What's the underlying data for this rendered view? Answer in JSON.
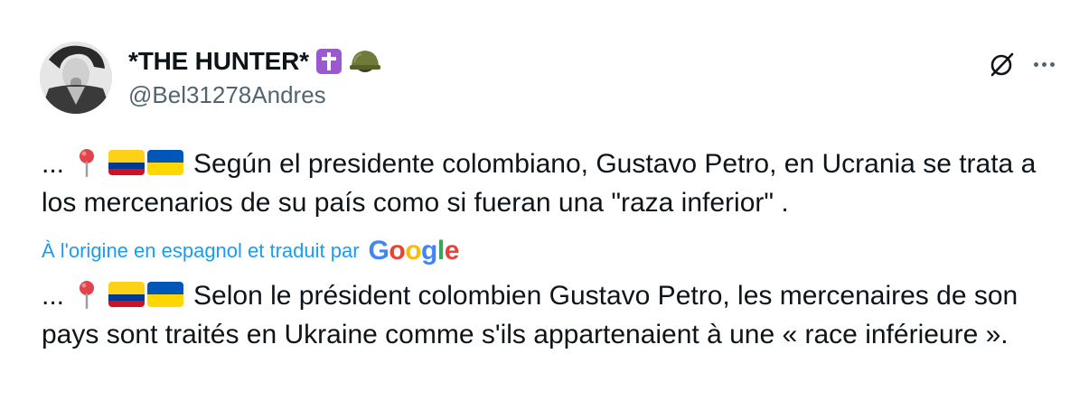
{
  "author": {
    "display_name": "*THE HUNTER*",
    "badges": [
      "latin-cross-icon",
      "military-helmet-icon"
    ],
    "handle": "@Bel31278Andres"
  },
  "header_actions": [
    "grok-icon",
    "more-icon"
  ],
  "post": {
    "original": {
      "prefix": "...",
      "emojis": [
        "round-pushpin-icon",
        "colombia-flag-icon",
        "ukraine-flag-icon"
      ],
      "text": "Según el presidente colombiano, Gustavo Petro, en Ucrania se trata a los mercenarios de su país como si fueran una \"raza inferior\" ."
    },
    "translation_notice": {
      "text": "À l'origine en espagnol et traduit par",
      "provider": "Google"
    },
    "translated": {
      "prefix": "...",
      "emojis": [
        "round-pushpin-icon",
        "colombia-flag-icon",
        "ukraine-flag-icon"
      ],
      "text": "Selon le président colombien Gustavo Petro, les mercenaires de son pays sont traités en Ukraine comme s'ils appartenaient à une « race inférieure »."
    }
  },
  "colors": {
    "text": "#0f1419",
    "secondary": "#536471",
    "link": "#1d9bf0",
    "badge_purple": "#9b59d0"
  }
}
